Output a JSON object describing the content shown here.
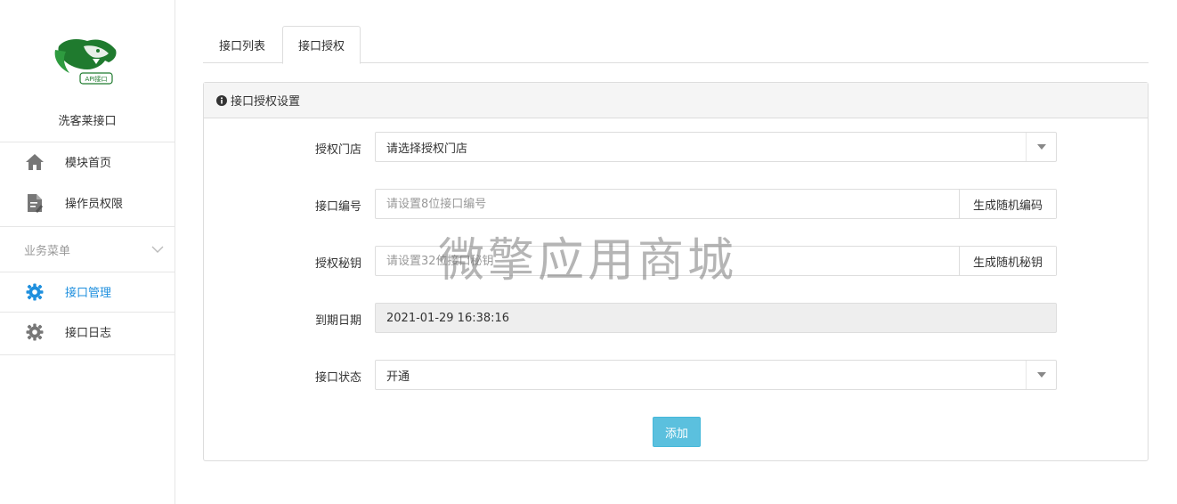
{
  "sidebar": {
    "brand_name": "洗客莱接口",
    "logo_caption": "API接口",
    "items": [
      {
        "label": "模块首页",
        "icon": "home-icon"
      },
      {
        "label": "操作员权限",
        "icon": "document-edit-icon"
      }
    ],
    "section_title": "业务菜单",
    "section_items": [
      {
        "label": "接口管理",
        "icon": "gear-icon",
        "active": true
      },
      {
        "label": "接口日志",
        "icon": "gear-icon",
        "active": false
      }
    ]
  },
  "tabs": [
    {
      "label": "接口列表"
    },
    {
      "label": "接口授权"
    }
  ],
  "panel": {
    "title": "接口授权设置",
    "fields": {
      "store": {
        "label": "授权门店",
        "value": "请选择授权门店"
      },
      "code": {
        "label": "接口编号",
        "placeholder": "请设置8位接口编号",
        "button": "生成随机编码"
      },
      "secret": {
        "label": "授权秘钥",
        "placeholder": "请设置32位接口秘钥",
        "button": "生成随机秘钥"
      },
      "expire": {
        "label": "到期日期",
        "value": "2021-01-29 16:38:16"
      },
      "status": {
        "label": "接口状态",
        "value": "开通"
      }
    },
    "submit_label": "添加"
  },
  "watermark": "微擎应用商城",
  "colors": {
    "accent": "#1e8fde",
    "submit": "#5bc0de",
    "logo_green": "#1f7a2e"
  }
}
